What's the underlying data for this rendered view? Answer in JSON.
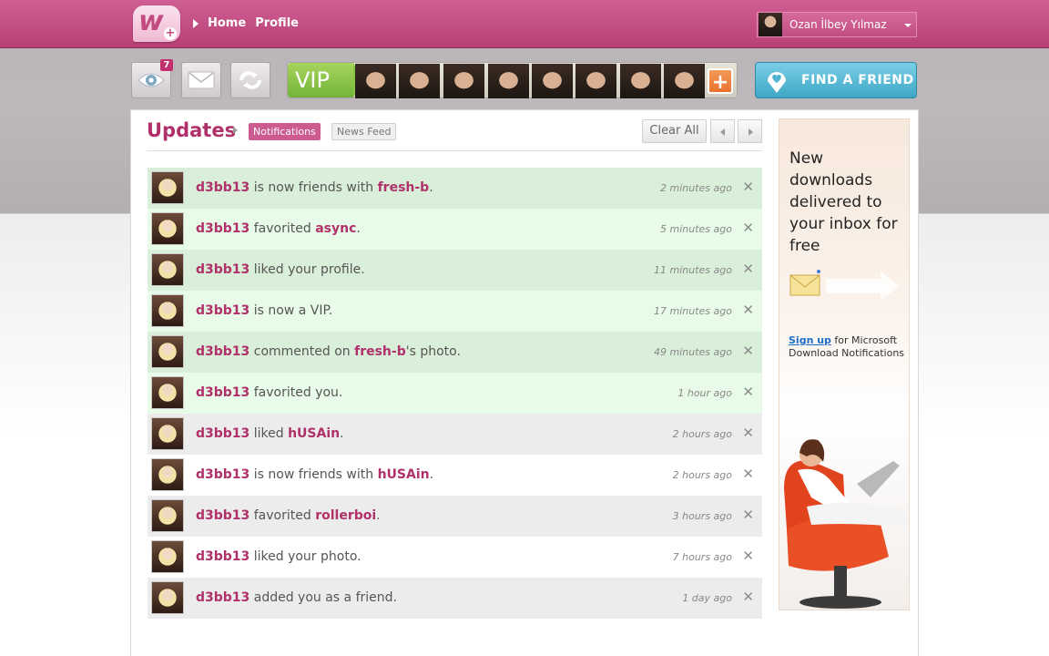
{
  "header": {
    "logo_letter": "w",
    "logo_badge": "+",
    "nav": [
      "Home",
      "Profile"
    ],
    "user_name": "Ozan İlbey Yılmaz"
  },
  "toolbar": {
    "views_badge": "7",
    "vip_label": "VIP",
    "add_label": "+",
    "find_friend_label": "FIND A FRIEND",
    "vip_member_count": 8
  },
  "updates": {
    "title": "Updates",
    "tab_active": "Notifications",
    "tab_inactive": "News Feed",
    "clear_all": "Clear All",
    "items": [
      {
        "user": "d3bb13",
        "text": " is now friends with ",
        "target": "fresh-b",
        "suffix": ".",
        "time": "2 minutes ago",
        "bg": "#d9efd9"
      },
      {
        "user": "d3bb13",
        "text": " favorited ",
        "target": "async",
        "suffix": ".",
        "time": "5 minutes ago",
        "bg": "#e8fbe8"
      },
      {
        "user": "d3bb13",
        "text": " liked your profile.",
        "target": "",
        "suffix": "",
        "time": "11 minutes ago",
        "bg": "#d9efd9"
      },
      {
        "user": "d3bb13",
        "text": " is now a VIP.",
        "target": "",
        "suffix": "",
        "time": "17 minutes ago",
        "bg": "#e8fbe8"
      },
      {
        "user": "d3bb13",
        "text": " commented on ",
        "target": "fresh-b",
        "suffix": "'s photo.",
        "time": "49 minutes ago",
        "bg": "#d9efd9"
      },
      {
        "user": "d3bb13",
        "text": " favorited you.",
        "target": "",
        "suffix": "",
        "time": "1 hour ago",
        "bg": "#e8fbe8"
      },
      {
        "user": "d3bb13",
        "text": " liked ",
        "target": "hUSAin",
        "suffix": ".",
        "time": "2 hours ago",
        "bg": "#ececec"
      },
      {
        "user": "d3bb13",
        "text": " is now friends with ",
        "target": "hUSAin",
        "suffix": ".",
        "time": "2 hours ago",
        "bg": "#ffffff"
      },
      {
        "user": "d3bb13",
        "text": " favorited ",
        "target": "rollerboi",
        "suffix": ".",
        "time": "3 hours ago",
        "bg": "#ececec"
      },
      {
        "user": "d3bb13",
        "text": " liked your photo.",
        "target": "",
        "suffix": "",
        "time": "7 hours ago",
        "bg": "#ffffff"
      },
      {
        "user": "d3bb13",
        "text": " added you as a friend.",
        "target": "",
        "suffix": "",
        "time": "1 day ago",
        "bg": "#ececec"
      }
    ],
    "close_glyph": "✕"
  },
  "ad": {
    "headline": "New downloads delivered to your inbox for free",
    "link": "Sign up",
    "rest": " for Microsoft Download Notifications"
  },
  "colors": {
    "brand": "#c24b81",
    "username": "#b0306a",
    "find_friend": "#3da7c5",
    "vip_green": "#86c045"
  }
}
